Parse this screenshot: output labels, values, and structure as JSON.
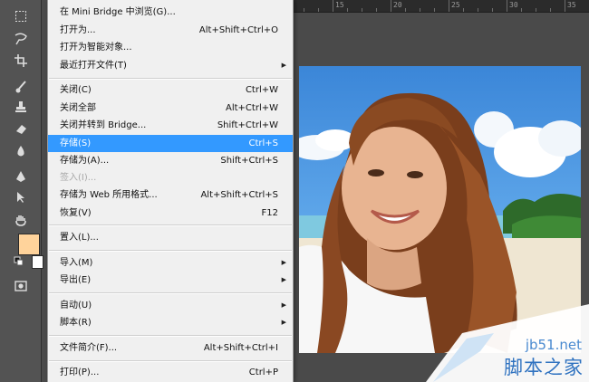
{
  "ruler": {
    "ticks": [
      "15",
      "20",
      "25",
      "30",
      "35"
    ]
  },
  "toolbar": {
    "tools": [
      "marquee-icon",
      "lasso-icon",
      "crop-icon",
      "brush-icon",
      "stamp-icon",
      "eraser-icon",
      "drop-icon",
      "pen-icon",
      "select-arrow-icon",
      "hand-icon"
    ],
    "foreground_color": "#ffd39b",
    "background_color": "#ffffff"
  },
  "file_menu": {
    "items": [
      {
        "label": "在 Mini Bridge 中浏览(G)...",
        "shortcut": ""
      },
      {
        "label": "打开为...",
        "shortcut": "Alt+Shift+Ctrl+O"
      },
      {
        "label": "打开为智能对象...",
        "shortcut": ""
      },
      {
        "label": "最近打开文件(T)",
        "shortcut": "",
        "submenu": true
      },
      {
        "label": "关闭(C)",
        "shortcut": "Ctrl+W"
      },
      {
        "label": "关闭全部",
        "shortcut": "Alt+Ctrl+W"
      },
      {
        "label": "关闭并转到 Bridge...",
        "shortcut": "Shift+Ctrl+W"
      },
      {
        "label": "存储(S)",
        "shortcut": "Ctrl+S",
        "highlighted": true
      },
      {
        "label": "存储为(A)...",
        "shortcut": "Shift+Ctrl+S"
      },
      {
        "label": "签入(I)...",
        "shortcut": "",
        "disabled": true
      },
      {
        "label": "存储为 Web 所用格式...",
        "shortcut": "Alt+Shift+Ctrl+S"
      },
      {
        "label": "恢复(V)",
        "shortcut": "F12"
      },
      {
        "label": "置入(L)...",
        "shortcut": ""
      },
      {
        "label": "导入(M)",
        "shortcut": "",
        "submenu": true
      },
      {
        "label": "导出(E)",
        "shortcut": "",
        "submenu": true
      },
      {
        "label": "自动(U)",
        "shortcut": "",
        "submenu": true
      },
      {
        "label": "脚本(R)",
        "shortcut": "",
        "submenu": true
      },
      {
        "label": "文件简介(F)...",
        "shortcut": "Alt+Shift+Ctrl+I"
      },
      {
        "label": "打印(P)...",
        "shortcut": "Ctrl+P"
      }
    ],
    "highlight_color": "#3399ff"
  },
  "watermark": {
    "url": "jb51.net",
    "name": "脚本之家"
  }
}
